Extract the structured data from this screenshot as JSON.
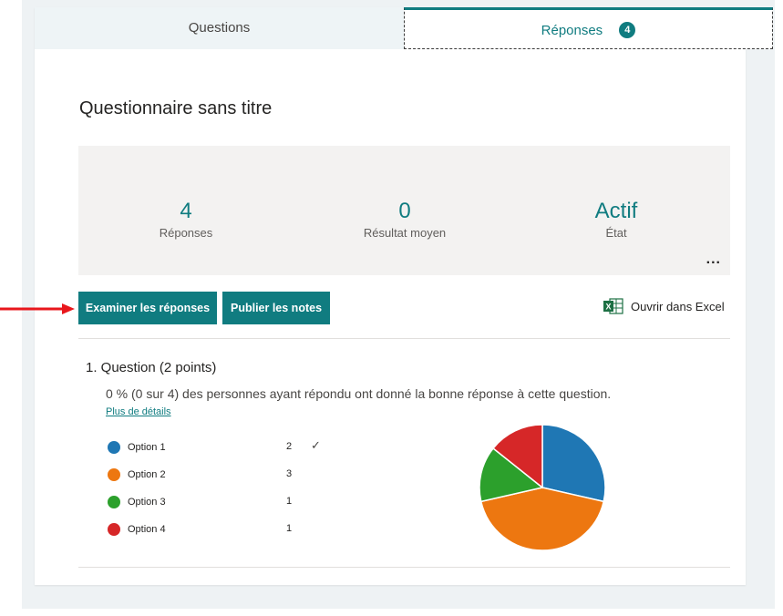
{
  "tabs": {
    "questions_label": "Questions",
    "responses_label": "Réponses",
    "responses_badge": "4"
  },
  "form": {
    "title": "Questionnaire sans titre"
  },
  "stats": {
    "responses_value": "4",
    "responses_label": "Réponses",
    "average_value": "0",
    "average_label": "Résultat moyen",
    "status_value": "Actif",
    "status_label": "État",
    "more_label": "..."
  },
  "actions": {
    "review_label": "Examiner les réponses",
    "publish_label": "Publier les notes",
    "excel_label": "Ouvrir dans Excel"
  },
  "question": {
    "title": "1. Question (2 points)",
    "summary": "0 % (0 sur 4) des personnes ayant répondu ont donné la bonne réponse à cette question.",
    "details_link": "Plus de détails",
    "options": [
      {
        "label": "Option 1",
        "count": "2",
        "correct": true,
        "color": "#1f77b4"
      },
      {
        "label": "Option 2",
        "count": "3",
        "correct": false,
        "color": "#ed7710"
      },
      {
        "label": "Option 3",
        "count": "1",
        "correct": false,
        "color": "#2ca02c"
      },
      {
        "label": "Option 4",
        "count": "1",
        "correct": false,
        "color": "#d62728"
      }
    ],
    "check_icon": "checkmark-icon"
  },
  "chart_data": {
    "type": "pie",
    "categories": [
      "Option 1",
      "Option 2",
      "Option 3",
      "Option 4"
    ],
    "values": [
      2,
      3,
      1,
      1
    ],
    "colors": [
      "#1f77b4",
      "#ed7710",
      "#2ca02c",
      "#d62728"
    ]
  },
  "colors": {
    "accent": "#107c80",
    "arrow": "#e8171c"
  }
}
